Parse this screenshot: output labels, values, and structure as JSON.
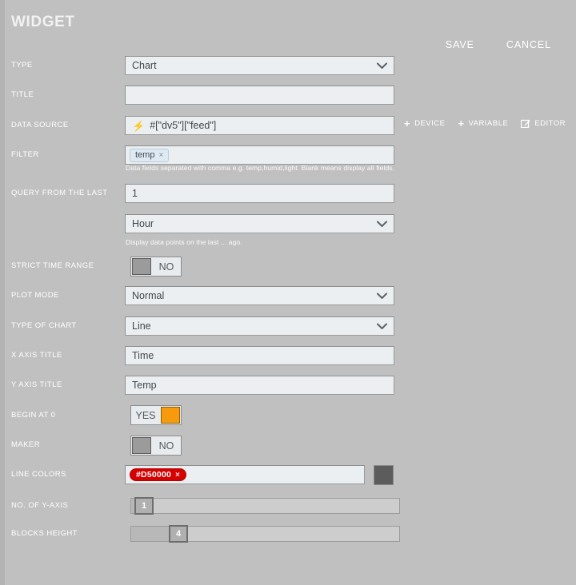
{
  "header": {
    "title": "WIDGET",
    "save_label": "SAVE",
    "cancel_label": "CANCEL"
  },
  "fields": {
    "type": {
      "label": "TYPE",
      "value": "Chart"
    },
    "title": {
      "label": "TITLE",
      "value": "",
      "placeholder": ""
    },
    "data_source": {
      "label": "DATA SOURCE",
      "value": "#[\"dv5\"][\"feed\"]",
      "bolt_icon": "lightning-bolt-icon",
      "actions": [
        {
          "label": "DEVICE",
          "icon": "plus-icon"
        },
        {
          "label": "VARIABLE",
          "icon": "plus-icon"
        },
        {
          "label": "EDITOR",
          "icon": "edit-square-icon"
        }
      ]
    },
    "filter": {
      "label": "FILTER",
      "chips": [
        "temp"
      ],
      "helper": "Data fields separated with comma e.g. temp,humid,light. Blank means display all fields."
    },
    "query_from_the_last": {
      "label": "QUERY FROM THE LAST",
      "amount": "1",
      "unit": "Hour",
      "helper": "Display data points on the last ... ago."
    },
    "strict_time_range": {
      "label": "STRICT TIME RANGE",
      "value": "NO",
      "state": "off"
    },
    "plot_mode": {
      "label": "PLOT MODE",
      "value": "Normal"
    },
    "type_of_chart": {
      "label": "TYPE OF CHART",
      "value": "Line"
    },
    "x_axis_title": {
      "label": "X AXIS TITLE",
      "value": "Time"
    },
    "y_axis_title": {
      "label": "Y AXIS TITLE",
      "value": "Temp"
    },
    "begin_at_0": {
      "label": "BEGIN AT 0",
      "value": "YES",
      "state": "on"
    },
    "maker": {
      "label": "MAKER",
      "value": "NO",
      "state": "off"
    },
    "line_colors": {
      "label": "LINE COLORS",
      "chips": [
        "#D50000"
      ],
      "swatch_color": "#5C5C5C"
    },
    "no_of_y_axis": {
      "label": "NO. OF Y-AXIS",
      "value": "1"
    },
    "blocks_height": {
      "label": "BLOCKS HEIGHT",
      "value": "4"
    }
  },
  "colors": {
    "background": "#C0C0C0",
    "label_text": "#FFFFFF",
    "field_background": "#ECEFF1",
    "accent_orange": "#F79B0C",
    "chip_red": "#D50000",
    "bolt_blue": "#1C7CE8"
  }
}
